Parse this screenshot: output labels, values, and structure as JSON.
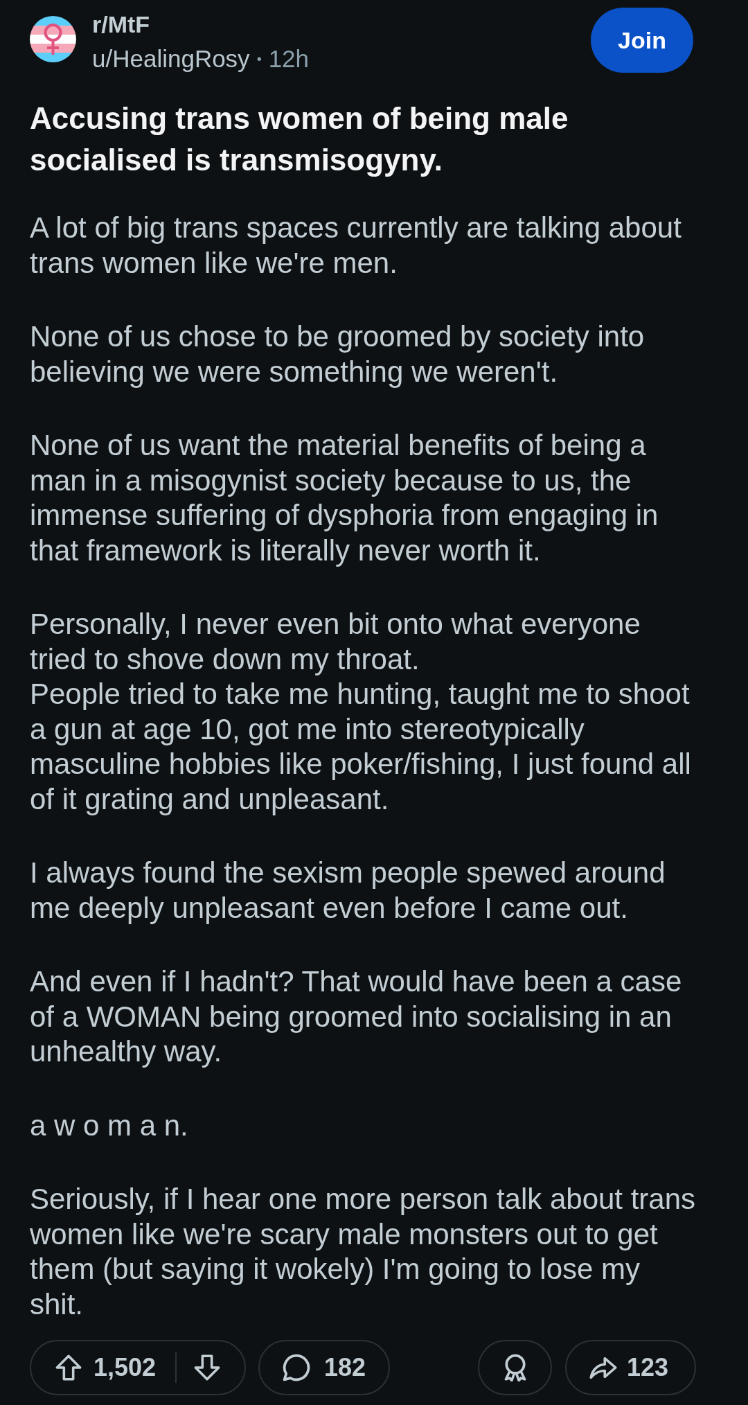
{
  "post": {
    "community": "r/MtF",
    "author": "u/HealingRosy",
    "separator": "•",
    "age": "12h",
    "join_button": "Join",
    "title": "Accusing trans women of being male socialised is transmisogyny.",
    "body": [
      "A lot of big trans spaces currently are talking about trans women like we're men.",
      "None of us chose to be groomed by society into believing we were something we weren't.",
      "None of us want the material benefits of being a man in a misogynist society because to us, the immense suffering of dysphoria from engaging in that framework is literally never worth it.",
      "Personally, I never even bit onto what everyone tried to shove down my throat.\nPeople tried to take me hunting, taught me to shoot a gun at age 10, got me into stereotypically masculine hobbies like poker/fishing, I just found all of it grating and unpleasant.",
      "I always found the sexism people spewed around me deeply unpleasant even before I came out.",
      "And even if I hadn't? That would have been a case of a WOMAN being groomed into socialising in an unhealthy way.",
      "a w o m a n.",
      "Seriously, if I hear one more person talk about trans women like we're scary male monsters out to get them (but saying it wokely) I'm going to lose my shit."
    ]
  },
  "actions": {
    "score": "1,502",
    "comments": "182",
    "shares": "123"
  }
}
